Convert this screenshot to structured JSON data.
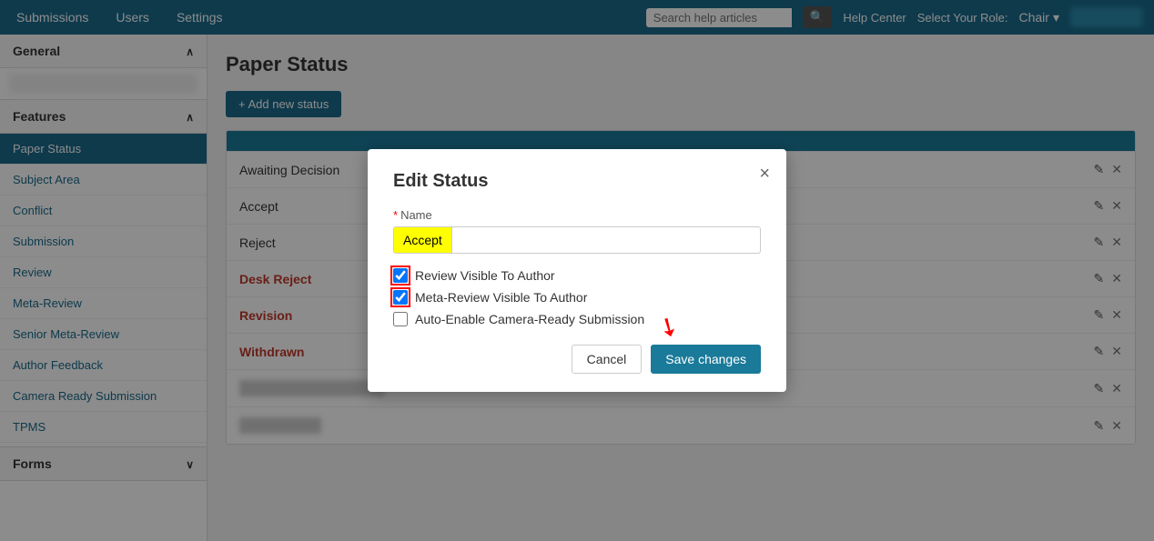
{
  "topNav": {
    "links": [
      "Submissions",
      "Users",
      "Settings"
    ],
    "searchPlaceholder": "Search help articles",
    "helpCenter": "Help Center",
    "selectRole": "Select Your Role:",
    "chair": "Chair",
    "userBtn": "User Account"
  },
  "sidebar": {
    "general": "General",
    "features": "Features",
    "forms": "Forms",
    "items": [
      {
        "label": "Paper Status",
        "active": true
      },
      {
        "label": "Subject Area",
        "active": false
      },
      {
        "label": "Conflict",
        "active": false
      },
      {
        "label": "Submission",
        "active": false
      },
      {
        "label": "Review",
        "active": false
      },
      {
        "label": "Meta-Review",
        "active": false
      },
      {
        "label": "Senior Meta-Review",
        "active": false
      },
      {
        "label": "Author Feedback",
        "active": false
      },
      {
        "label": "Camera Ready Submission",
        "active": false
      },
      {
        "label": "TPMS",
        "active": false
      }
    ]
  },
  "mainContent": {
    "title": "Paper Status",
    "addButton": "+ Add new status",
    "statuses": [
      {
        "name": "Awaiting Decision",
        "color": "normal"
      },
      {
        "name": "Accept",
        "color": "normal"
      },
      {
        "name": "Reject",
        "color": "normal"
      },
      {
        "name": "Desk Reject",
        "color": "red"
      },
      {
        "name": "Revision",
        "color": "red"
      },
      {
        "name": "Withdrawn",
        "color": "red"
      }
    ]
  },
  "modal": {
    "title": "Edit Status",
    "nameLabel": "Name",
    "nameValue": "Accept",
    "checkbox1": "Review Visible To Author",
    "checkbox2": "Meta-Review Visible To Author",
    "checkbox3": "Auto-Enable Camera-Ready Submission",
    "check1": true,
    "check2": true,
    "check3": false,
    "cancelLabel": "Cancel",
    "saveLabel": "Save changes"
  }
}
